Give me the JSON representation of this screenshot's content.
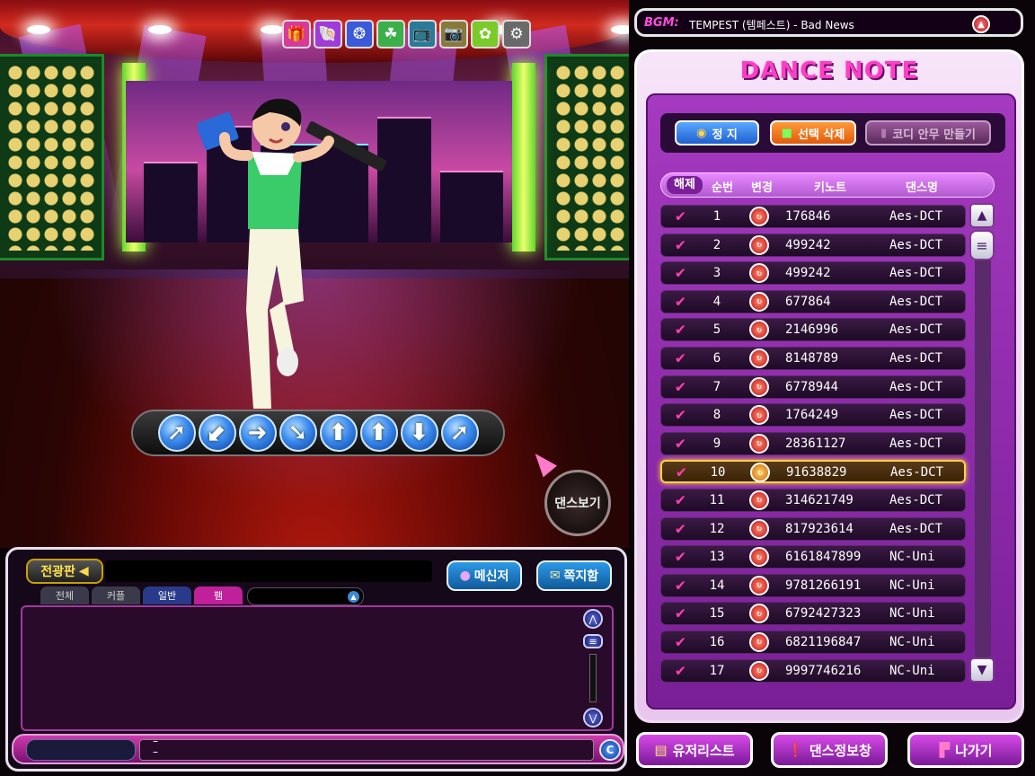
{
  "bgm": {
    "label": "BGM:",
    "title": "TEMPEST (템페스트) - Bad News"
  },
  "top_icons": [
    {
      "name": "gift-icon",
      "glyph": "🎁",
      "color": "#d83a9a"
    },
    {
      "name": "shell-icon",
      "glyph": "🐚",
      "color": "#a13ad8"
    },
    {
      "name": "dots-icon",
      "glyph": "❂",
      "color": "#3a5ad8"
    },
    {
      "name": "leaf-icon",
      "glyph": "☘",
      "color": "#3ab04a"
    },
    {
      "name": "tv-icon",
      "glyph": "📺",
      "color": "#2a7a9a"
    },
    {
      "name": "photo-icon",
      "glyph": "📷",
      "color": "#8a7a3a"
    },
    {
      "name": "garden-icon",
      "glyph": "✿",
      "color": "#7acb2a"
    },
    {
      "name": "wrench-icon",
      "glyph": "⚙",
      "color": "#6a6a6a"
    }
  ],
  "dance_view_label": "댄스보기",
  "arrows": [
    {
      "dir": "up-right",
      "glyph": "➚"
    },
    {
      "dir": "down-left",
      "glyph": "⬋"
    },
    {
      "dir": "right",
      "glyph": "➜"
    },
    {
      "dir": "down-right",
      "glyph": "➘"
    },
    {
      "dir": "up",
      "glyph": "⬆"
    },
    {
      "dir": "up",
      "glyph": "⬆"
    },
    {
      "dir": "down",
      "glyph": "⬇"
    },
    {
      "dir": "up-right",
      "glyph": "➚"
    }
  ],
  "chat": {
    "marquee_label": "전광판",
    "messenger_label": "메신저",
    "mailbox_label": "쪽지함",
    "tabs": [
      "전체",
      "커플",
      "일반",
      "팸"
    ],
    "scroll_up_glyph": "⋀",
    "scroll_down_glyph": "⋁",
    "send_glyph": "C",
    "channel_marker": "–"
  },
  "dance_note": {
    "title": "DANCE NOTE",
    "stop_label": "정 지",
    "delete_label": "선택 삭제",
    "create_label": "코디 안무 만들기",
    "headers": {
      "release": "해제",
      "order": "순번",
      "change": "변경",
      "key": "키노트",
      "name": "댄스명"
    },
    "check_glyph": "✔",
    "change_glyph": "↻",
    "rows": [
      {
        "num": "1",
        "key": "176846",
        "name": "Aes-DCT"
      },
      {
        "num": "2",
        "key": "499242",
        "name": "Aes-DCT"
      },
      {
        "num": "3",
        "key": "499242",
        "name": "Aes-DCT"
      },
      {
        "num": "4",
        "key": "677864",
        "name": "Aes-DCT"
      },
      {
        "num": "5",
        "key": "2146996",
        "name": "Aes-DCT"
      },
      {
        "num": "6",
        "key": "8148789",
        "name": "Aes-DCT"
      },
      {
        "num": "7",
        "key": "6778944",
        "name": "Aes-DCT"
      },
      {
        "num": "8",
        "key": "1764249",
        "name": "Aes-DCT"
      },
      {
        "num": "9",
        "key": "28361127",
        "name": "Aes-DCT"
      },
      {
        "num": "10",
        "key": "91638829",
        "name": "Aes-DCT",
        "selected": true
      },
      {
        "num": "11",
        "key": "314621749",
        "name": "Aes-DCT"
      },
      {
        "num": "12",
        "key": "817923614",
        "name": "Aes-DCT"
      },
      {
        "num": "13",
        "key": "6161847899",
        "name": "NC-Uni"
      },
      {
        "num": "14",
        "key": "9781266191",
        "name": "NC-Uni"
      },
      {
        "num": "15",
        "key": "6792427323",
        "name": "NC-Uni"
      },
      {
        "num": "16",
        "key": "6821196847",
        "name": "NC-Uni"
      },
      {
        "num": "17",
        "key": "9997746216",
        "name": "NC-Uni"
      }
    ]
  },
  "bottom": {
    "userlist_label": "유저리스트",
    "danceinfo_label": "댄스정보창",
    "exit_label": "나가기"
  },
  "colors": {
    "accent_pink": "#ff3ec8",
    "panel_purple": "#7a1f98",
    "selected_row_border": "#ffd43a"
  }
}
